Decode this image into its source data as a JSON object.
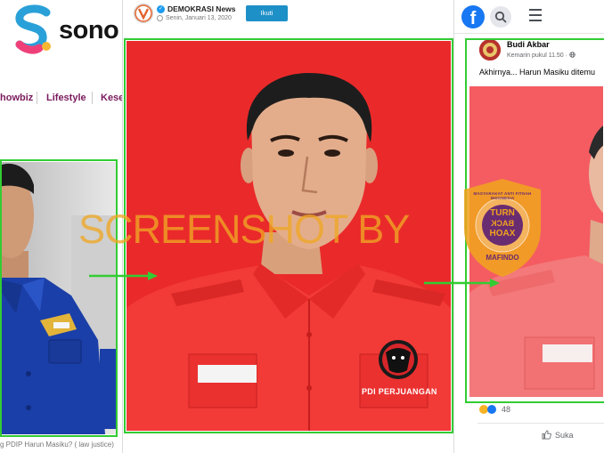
{
  "left": {
    "brand": "sono",
    "nav": [
      "howbiz",
      "Lifestyle",
      "Kese"
    ],
    "caption": "g PDIP Harun Masiku?   ( law justice)"
  },
  "middle": {
    "publisher": "DEMOKRASI News",
    "date": "Senin, Januari 13, 2020",
    "follow_label": "Ikuti",
    "pin_text": "PDI PERJUANGAN"
  },
  "right": {
    "logo": "f",
    "author": "Budi Akbar",
    "time": "Kemarin pukul 11.50 ·",
    "text": "Akhirnya... Harun Masiku ditemu",
    "reaction_count": "48",
    "like_label": "Suka"
  },
  "overlay": {
    "watermark": "SCREENSHOT BY",
    "badge": {
      "ring_text": "MASYARAKAT ANTI FITNAH INDONESIA",
      "line1": "TURN",
      "line2": "BACK",
      "line3": "HOAX",
      "org": "MAFINDO"
    }
  },
  "colors": {
    "frame": "#33cc33",
    "mid_bg": "#ea2a2a",
    "fb_blue": "#1877f2",
    "badge_orange": "#f0a31f",
    "badge_purple": "#6a2c70"
  },
  "icons": {
    "fb_search": "search-icon",
    "fb_menu": "hamburger-menu-icon",
    "verified": "verified-check-icon",
    "clock": "clock-icon",
    "globe": "globe-icon",
    "like": "thumbs-up-icon"
  }
}
